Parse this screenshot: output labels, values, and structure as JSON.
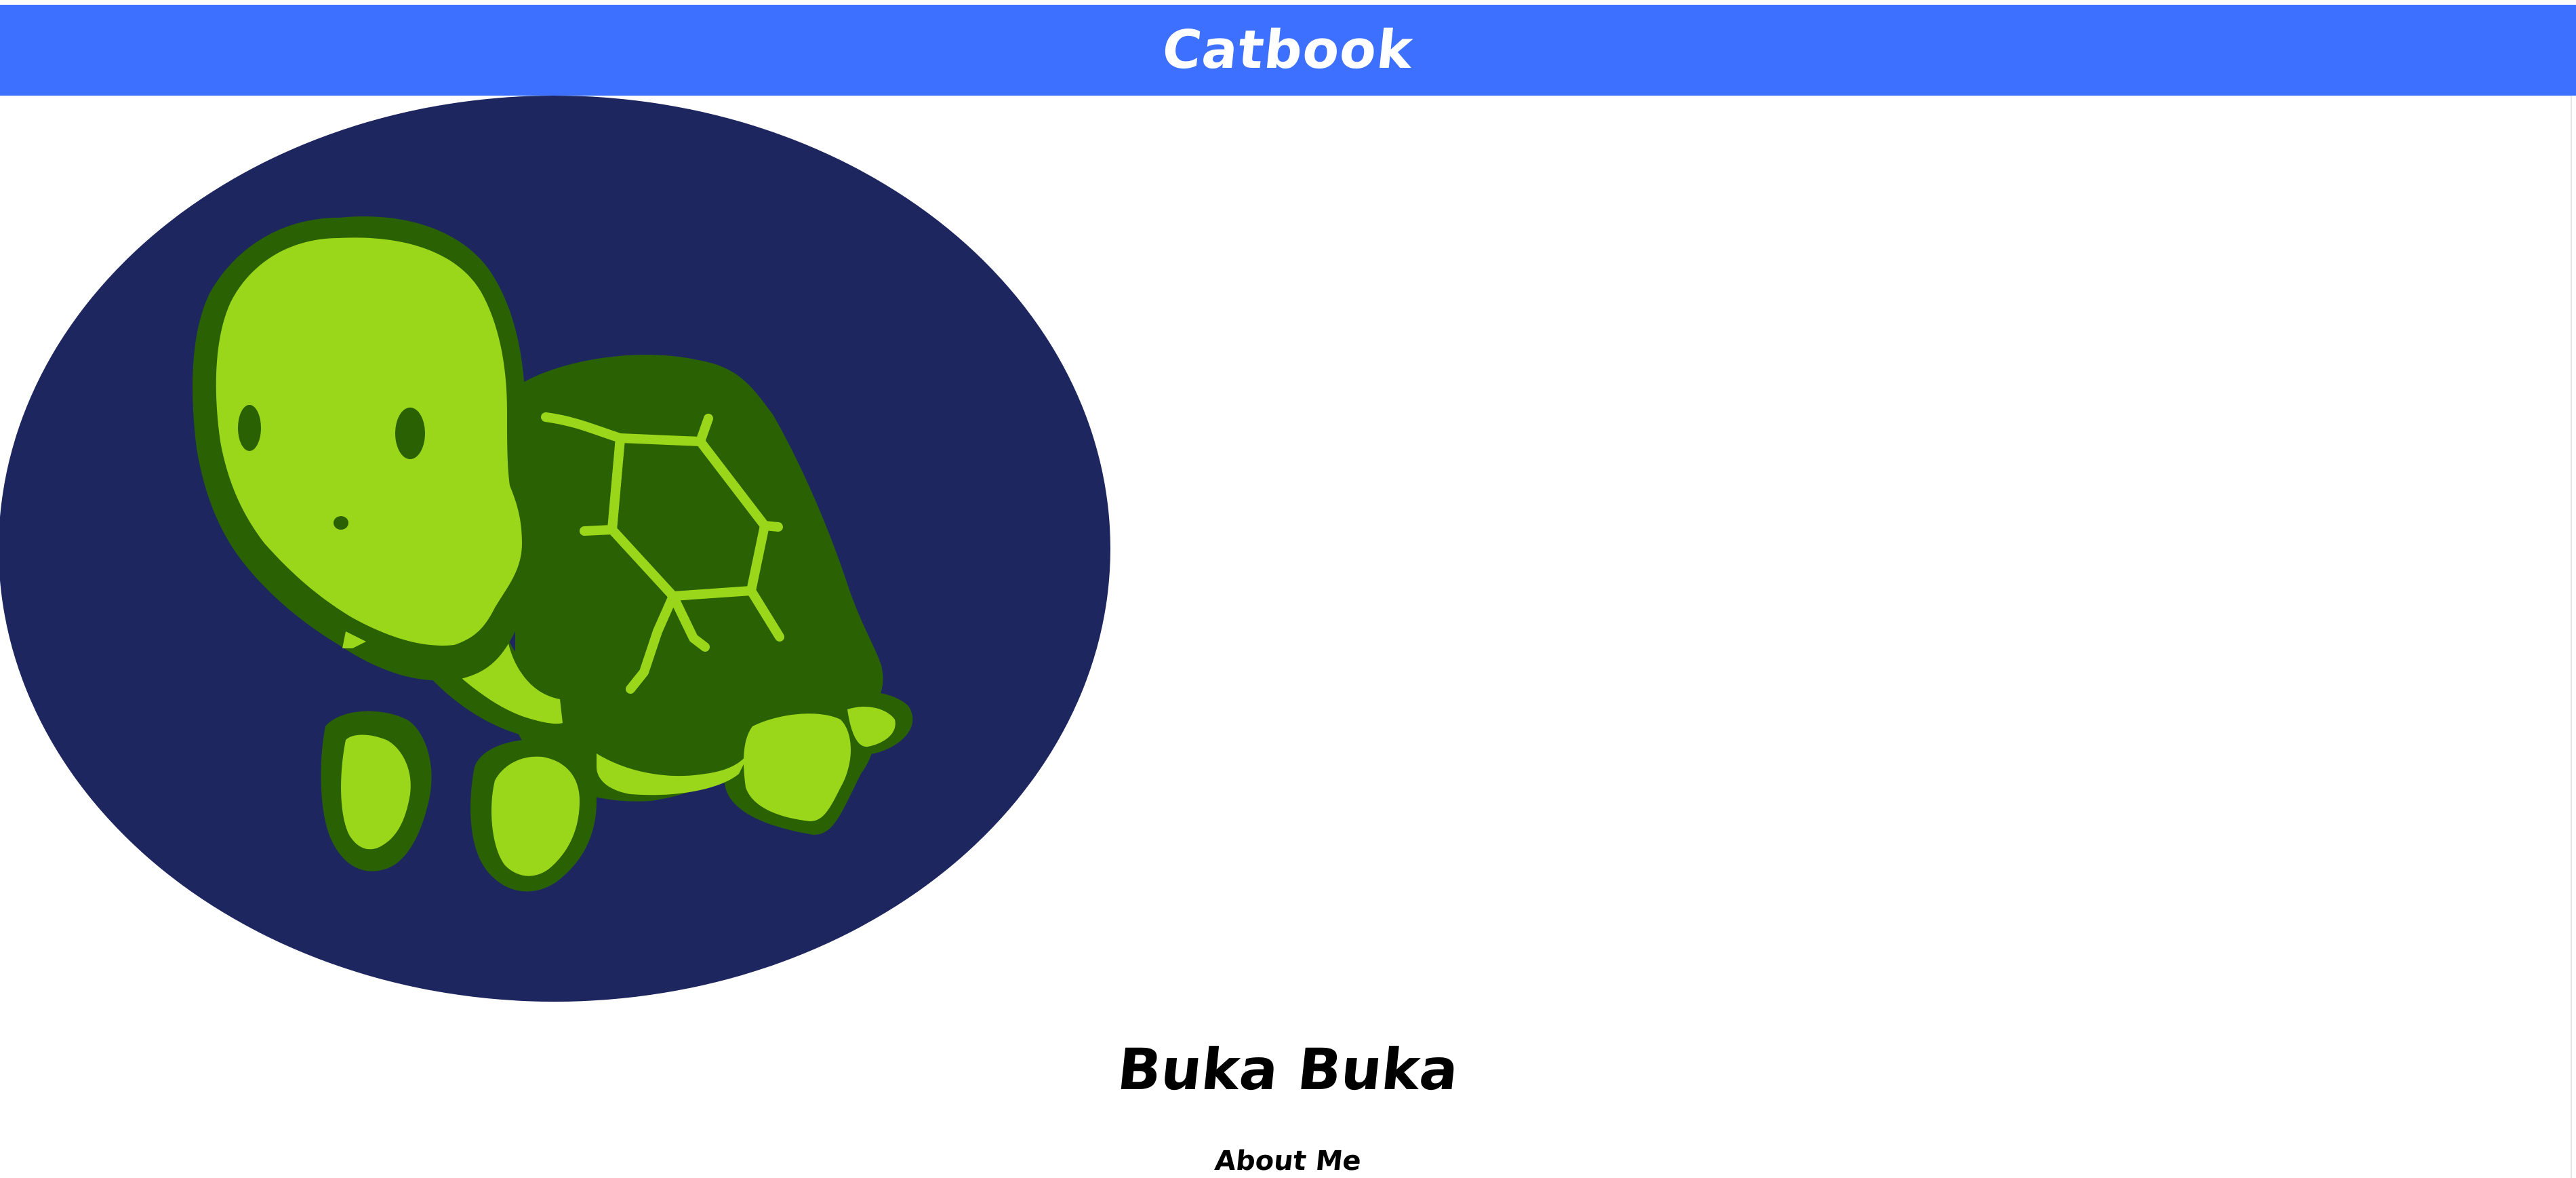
{
  "header": {
    "title": "Catbook"
  },
  "profile": {
    "avatar_icon": "turtle-icon",
    "name": "Buka Buka",
    "about_heading": "About Me"
  },
  "colors": {
    "header_bg": "#3d70ff",
    "avatar_bg": "#1e2660",
    "turtle_dark": "#2a6103",
    "turtle_light": "#9ad71a",
    "text": "#000000",
    "page_bg": "#ffffff"
  }
}
